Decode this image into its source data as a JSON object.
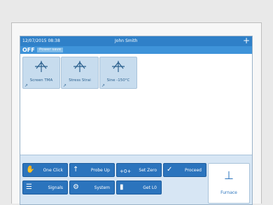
{
  "header": {
    "datetime": "12/07/2015 08:38",
    "user": "John Smith",
    "add_icon": "plus-icon"
  },
  "status": {
    "mode": "OFF",
    "power_label": "Power save"
  },
  "tiles": [
    {
      "label": "Screen TMA",
      "icon": "probe-icon"
    },
    {
      "label": "Stress Strai",
      "icon": "probe-icon"
    },
    {
      "label": "Sine -150°C",
      "icon": "probe-icon"
    }
  ],
  "toolbar": {
    "one_click": "One Click",
    "probe_up": "Probe Up",
    "set_zero": "Set Zero",
    "proceed": "Proceed",
    "signals": "Signals",
    "system": "System",
    "get_lo": "Get L0",
    "furnace": "Furnace"
  },
  "colors": {
    "title_bar": "#2f80c8",
    "button": "#2b74bd",
    "tile": "#c7dcee"
  }
}
